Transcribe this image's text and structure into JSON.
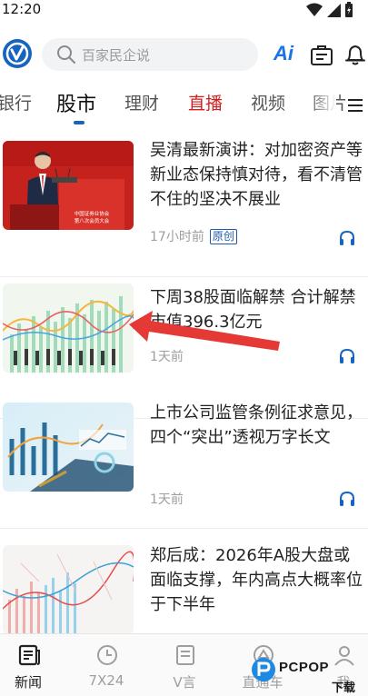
{
  "status_bar": {
    "time": "12:20"
  },
  "search": {
    "placeholder": "百家民企说"
  },
  "header": {
    "ai_label": "Ai"
  },
  "tabs": [
    {
      "label": "银行"
    },
    {
      "label": "股市"
    },
    {
      "label": "理财"
    },
    {
      "label": "直播"
    },
    {
      "label": "视频"
    },
    {
      "label": "图片"
    }
  ],
  "articles": [
    {
      "title": "吴清最新演讲：对加密资产等新业态保持慎对待，看不清管不住的坚决不展业",
      "time": "17小时前",
      "badge": "原创",
      "thumb_caption": "中国证券业协会 第八次会员大会"
    },
    {
      "title": "下周38股面临解禁 合计解禁市值396.3亿元",
      "time": "1天前"
    },
    {
      "title": "上市公司监管条例征求意见，四个“突出”透视万字长文",
      "time": "1天前"
    },
    {
      "title": "郑后成：2026年A股大盘或面临支撑，年内高点大概率位于下半年",
      "time": ""
    }
  ],
  "bottom_nav": [
    {
      "label": "新闻"
    },
    {
      "label": "7X24"
    },
    {
      "label": "V言"
    },
    {
      "label": "直通车"
    },
    {
      "label": "我"
    }
  ],
  "watermark": {
    "text": "PCPOP",
    "sub": "下载"
  },
  "colors": {
    "brand": "#1565c0",
    "live": "#d02020",
    "arrow": "#e53935"
  }
}
